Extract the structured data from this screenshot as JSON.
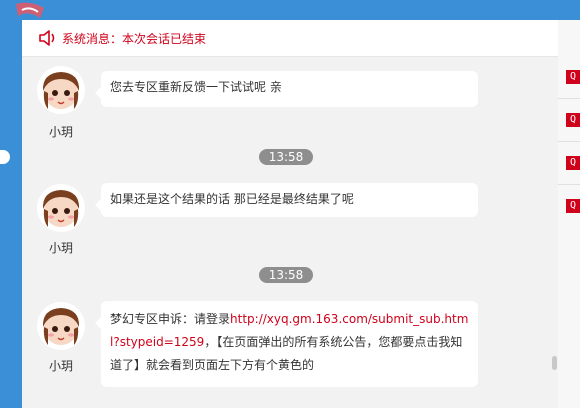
{
  "system": {
    "message": "系统消息：本次会话已结束"
  },
  "messages": [
    {
      "user": "小玥",
      "text": "您去专区重新反馈一下试试呢 亲"
    },
    {
      "time": "13:58",
      "user": "小玥",
      "text": "如果还是这个结果的话 那已经是最终结果了呢"
    },
    {
      "time": "13:58",
      "user": "小玥",
      "text_prefix": "梦幻专区申诉：请登录",
      "link": "http://xyq.gm.163.com/submit_sub.html?stypeid=1259",
      "text_suffix": "，【在页面弹出的所有系统公告，您都要点击我知道了】就会看到页面左下方有个黄色的"
    }
  ],
  "right_buttons": [
    "Q",
    "Q",
    "Q",
    "Q"
  ],
  "colors": {
    "accent": "#d0021b",
    "background": "#3a8fd6",
    "time_badge": "#8e8e8e"
  }
}
